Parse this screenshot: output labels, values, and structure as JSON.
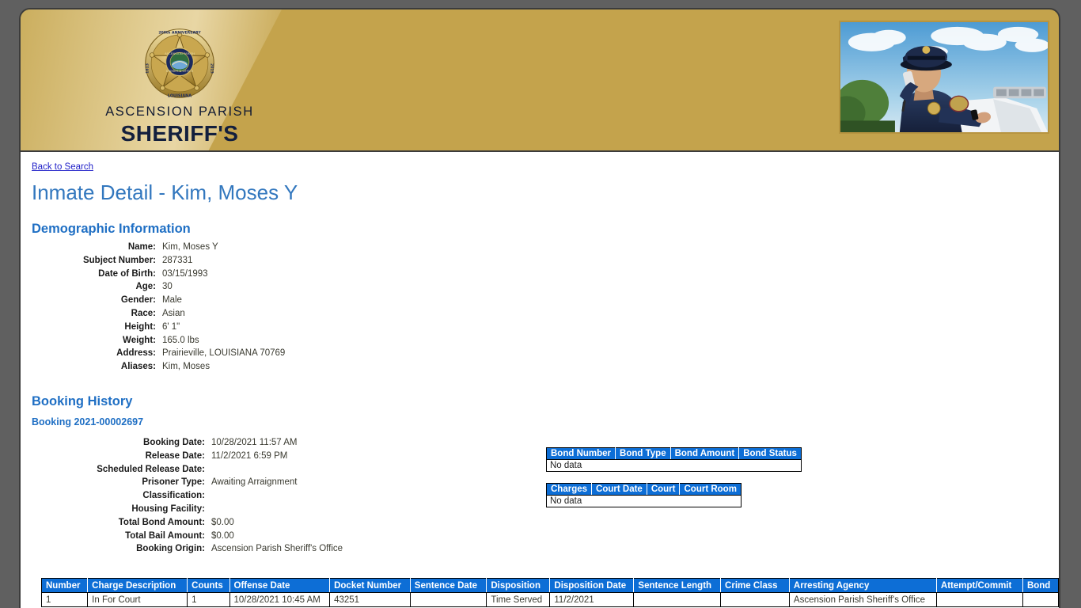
{
  "header": {
    "org_line1": "ASCENSION PARISH",
    "org_line2": "SHERIFF'S OFFICE",
    "badge_anniversary": "200th ANNIVERSARY",
    "badge_year_left": "1813",
    "badge_year_right": "2013",
    "badge_state": "LOUISIANA",
    "badge_inner_top": "ASCENSION PARISH",
    "badge_inner_bottom": "SHERIFF'S OFFICE",
    "photo_alt": "police-officer-with-radio-beside-patrol-car",
    "gold": "#C4A34C",
    "navy": "#131f3d"
  },
  "nav": {
    "back_link": "Back to Search"
  },
  "page_title": "Inmate Detail - Kim, Moses Y",
  "demographic": {
    "heading": "Demographic Information",
    "fields": [
      {
        "label": "Name:",
        "value": "Kim, Moses Y"
      },
      {
        "label": "Subject Number:",
        "value": "287331"
      },
      {
        "label": "Date of Birth:",
        "value": "03/15/1993"
      },
      {
        "label": "Age:",
        "value": "30"
      },
      {
        "label": "Gender:",
        "value": "Male"
      },
      {
        "label": "Race:",
        "value": "Asian"
      },
      {
        "label": "Height:",
        "value": "6' 1\""
      },
      {
        "label": "Weight:",
        "value": "165.0 lbs"
      },
      {
        "label": "Address:",
        "value": "Prairieville, LOUISIANA 70769"
      },
      {
        "label": "Aliases:",
        "value": "Kim, Moses"
      }
    ]
  },
  "booking": {
    "heading": "Booking History",
    "booking_number": "Booking 2021-00002697",
    "fields": [
      {
        "label": "Booking Date:",
        "value": "10/28/2021 11:57 AM"
      },
      {
        "label": "Release Date:",
        "value": "11/2/2021 6:59 PM"
      },
      {
        "label": "Scheduled Release Date:",
        "value": ""
      },
      {
        "label": "Prisoner Type:",
        "value": "Awaiting Arraignment"
      },
      {
        "label": "Classification:",
        "value": ""
      },
      {
        "label": "Housing Facility:",
        "value": ""
      },
      {
        "label": "Total Bond Amount:",
        "value": "$0.00"
      },
      {
        "label": "Total Bail Amount:",
        "value": "$0.00"
      },
      {
        "label": "Booking Origin:",
        "value": "Ascension Parish Sheriff's Office"
      }
    ]
  },
  "bond_table": {
    "columns": [
      "Bond Number",
      "Bond Type",
      "Bond Amount",
      "Bond Status"
    ],
    "empty_message": "No data",
    "rows": []
  },
  "court_table": {
    "columns": [
      "Charges",
      "Court Date",
      "Court",
      "Court Room"
    ],
    "empty_message": "No data",
    "rows": []
  },
  "charge_table": {
    "columns": [
      "Number",
      "Charge Description",
      "Counts",
      "Offense Date",
      "Docket Number",
      "Sentence Date",
      "Disposition",
      "Disposition Date",
      "Sentence Length",
      "Crime Class",
      "Arresting Agency",
      "Attempt/Commit",
      "Bond"
    ],
    "rows": [
      {
        "number": "1",
        "charge_description": "In For Court",
        "counts": "1",
        "offense_date": "10/28/2021 10:45 AM",
        "docket_number": "43251",
        "sentence_date": "",
        "disposition": "Time Served",
        "disposition_date": "11/2/2021",
        "sentence_length": "",
        "crime_class": "",
        "arresting_agency": "Ascension Parish Sheriff's Office",
        "attempt_commit": "",
        "bond": ""
      }
    ]
  },
  "theme": {
    "header_blue": "#0d6ed6",
    "title_blue": "#3277be",
    "section_blue": "#1f6fc4",
    "link_blue": "#2020c8",
    "page_gray": "#606060"
  }
}
